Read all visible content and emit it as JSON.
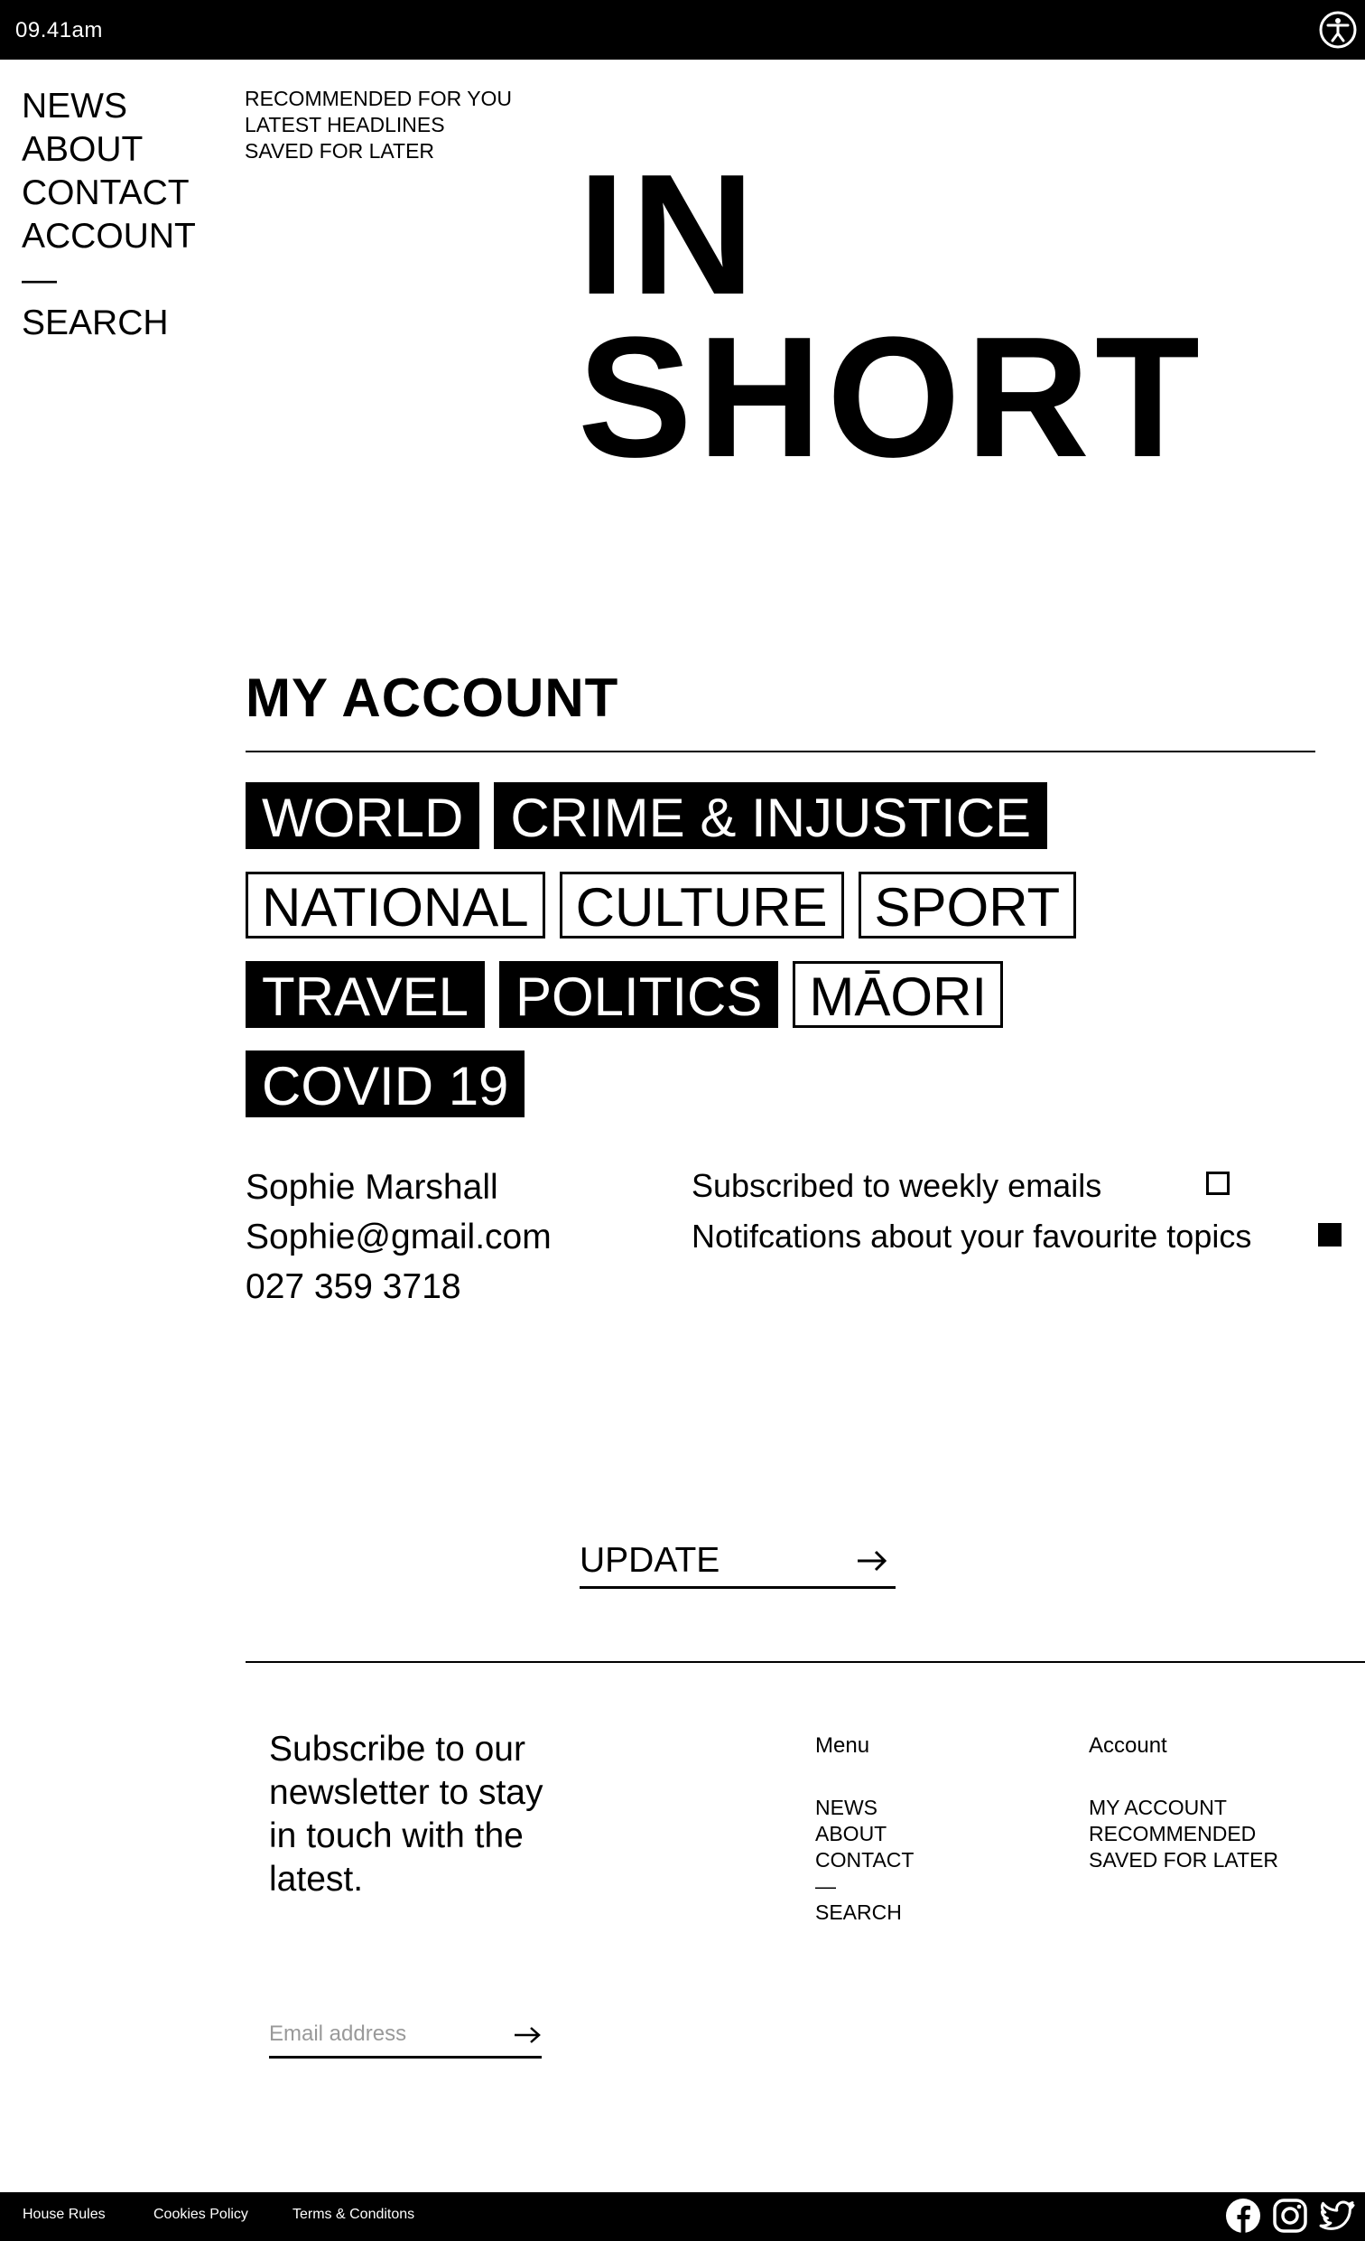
{
  "status_bar": {
    "time": "09.41am",
    "accessibility_icon": "accessibility-icon"
  },
  "main_nav": {
    "items": [
      "NEWS",
      "ABOUT",
      "CONTACT",
      "ACCOUNT"
    ],
    "separator": "—",
    "search": "SEARCH"
  },
  "sub_nav": {
    "items": [
      "RECOMMENDED FOR YOU",
      "LATEST HEADLINES",
      "SAVED FOR LATER"
    ]
  },
  "brand": {
    "line1": "IN",
    "line2": "SHORT"
  },
  "account": {
    "title": "MY ACCOUNT",
    "topics": [
      [
        {
          "label": "WORLD",
          "selected": true
        },
        {
          "label": "CRIME & INJUSTICE",
          "selected": true
        }
      ],
      [
        {
          "label": "NATIONAL",
          "selected": false
        },
        {
          "label": "CULTURE",
          "selected": false
        },
        {
          "label": "SPORT",
          "selected": false
        }
      ],
      [
        {
          "label": "TRAVEL",
          "selected": true
        },
        {
          "label": "POLITICS",
          "selected": true
        },
        {
          "label": "MĀORI",
          "selected": false
        }
      ],
      [
        {
          "label": "COVID 19",
          "selected": true
        }
      ]
    ],
    "profile": {
      "name": "Sophie Marshall",
      "email": "Sophie@gmail.com",
      "phone": "027 359 3718"
    },
    "prefs": [
      {
        "label": "Subscribed to weekly emails",
        "checked": false
      },
      {
        "label": "Notifcations about your favourite topics",
        "checked": true
      }
    ],
    "update_label": "UPDATE",
    "update_icon": "arrow-right-icon"
  },
  "footer": {
    "newsletter_text": "Subscribe to our newsletter to stay in touch with the latest.",
    "email_placeholder": "Email address",
    "menu": {
      "heading": "Menu",
      "items": [
        "NEWS",
        "ABOUT",
        "CONTACT",
        "—",
        "SEARCH"
      ]
    },
    "account": {
      "heading": "Account",
      "items": [
        "MY ACCOUNT",
        "RECOMMENDED",
        "SAVED FOR LATER"
      ]
    },
    "links": [
      "House Rules",
      "Cookies Policy",
      "Terms & Conditons"
    ],
    "social_icons": [
      "facebook-icon",
      "instagram-icon",
      "twitter-icon"
    ]
  },
  "colors": {
    "background": "#ffffff",
    "foreground": "#000000",
    "placeholder": "#999999"
  }
}
